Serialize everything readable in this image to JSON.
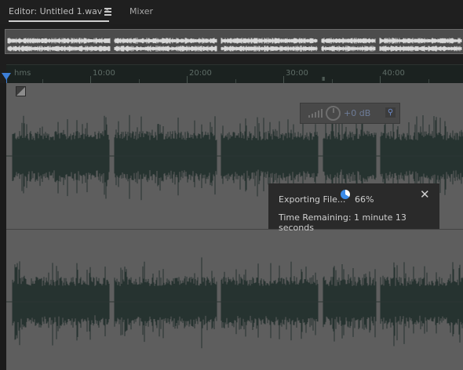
{
  "tabs": {
    "editor_label": "Editor: Untitled 1.wav *",
    "mixer_label": "Mixer"
  },
  "ruler": {
    "labels": [
      {
        "text": "hms"
      },
      {
        "text": "10:00"
      },
      {
        "text": "20:00"
      },
      {
        "text": "30:00"
      },
      {
        "text": "40:00"
      }
    ],
    "loop_marker": "III"
  },
  "hud": {
    "db": "+0 dB",
    "pin_icon": "pin-icon"
  },
  "export": {
    "title": "Exporting File...",
    "percent": "66%",
    "progress": 0.66,
    "remaining_label": "Time Remaining:",
    "remaining_value": "1 minute 13 seconds",
    "close_icon": "close-icon"
  },
  "colors": {
    "waveform": "#263330",
    "editor_bg": "#5e5e5e",
    "overview_wave": "#d8d8d8",
    "playhead": "#3d7fd8",
    "spinner": "#3b8be8"
  }
}
